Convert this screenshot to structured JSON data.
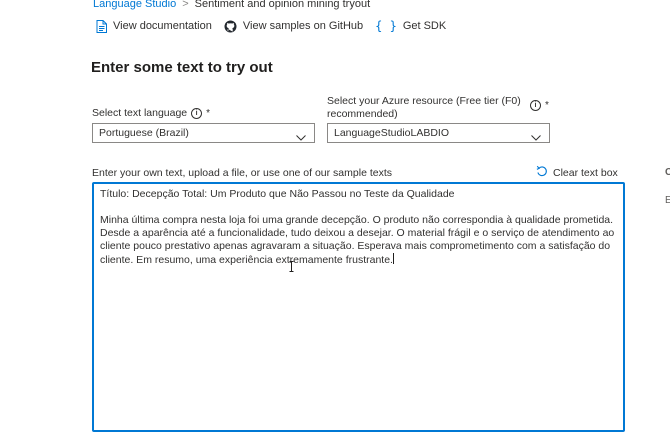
{
  "breadcrumb": {
    "root": "Language Studio",
    "separator": ">",
    "current": "Sentiment and opinion mining tryout"
  },
  "toolbar": {
    "documentation_label": "View documentation",
    "github_label": "View samples on GitHub",
    "sdk_label": "Get SDK",
    "icons": [
      "document-icon",
      "github-icon",
      "code-braces-icon"
    ]
  },
  "page_title": "Enter some text to try out",
  "language": {
    "label": "Select text language",
    "required_mark": "*",
    "selected": "Portuguese (Brazil)"
  },
  "resource": {
    "label": "Select your Azure resource (Free tier (F0) recommended)",
    "required_mark": "*",
    "selected": "LanguageStudioLABDIO"
  },
  "input": {
    "label": "Enter your own text, upload a file, or use one of our sample texts",
    "clear_label": "Clear text box",
    "title_line": "Título: Decepção Total: Um Produto que Não Passou no Teste da Qualidade",
    "body": "Minha última compra nesta loja foi uma grande decepção. O produto não correspondia à qualidade prometida. Desde a aparência até a funcionalidade, tudo deixou a desejar. O material frágil e o serviço de atendimento ao cliente pouco prestativo apenas agravaram a situação. Esperava mais comprometimento com a satisfação do cliente. Em resumo, uma experiência extremamente frustrante."
  },
  "edge_text": {
    "c": "C",
    "e": "E"
  },
  "colors": {
    "accent": "#0078d4",
    "text": "#323130",
    "border": "#8a8886"
  }
}
